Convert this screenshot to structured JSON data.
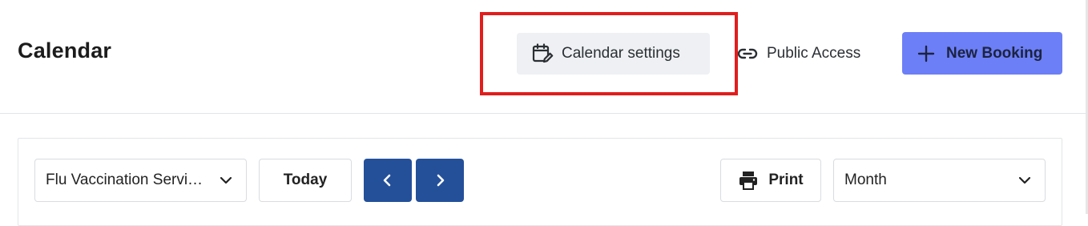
{
  "header": {
    "title": "Calendar",
    "calendar_settings_label": "Calendar settings",
    "public_access_label": "Public Access",
    "new_booking_label": "New Booking"
  },
  "toolbar": {
    "service_select_value": "Flu Vaccination Servi…",
    "today_label": "Today",
    "print_label": "Print",
    "view_select_value": "Month"
  },
  "colors": {
    "primary_button": "#6c7ff6",
    "nav_button": "#24509a",
    "highlight": "#e11d1d"
  },
  "icons": {
    "calendar_settings": "calendar-edit-icon",
    "public_access": "link-icon",
    "new_booking": "plus-icon",
    "prev": "chevron-left-icon",
    "next": "chevron-right-icon",
    "print": "printer-icon",
    "dropdown": "chevron-down-icon"
  }
}
